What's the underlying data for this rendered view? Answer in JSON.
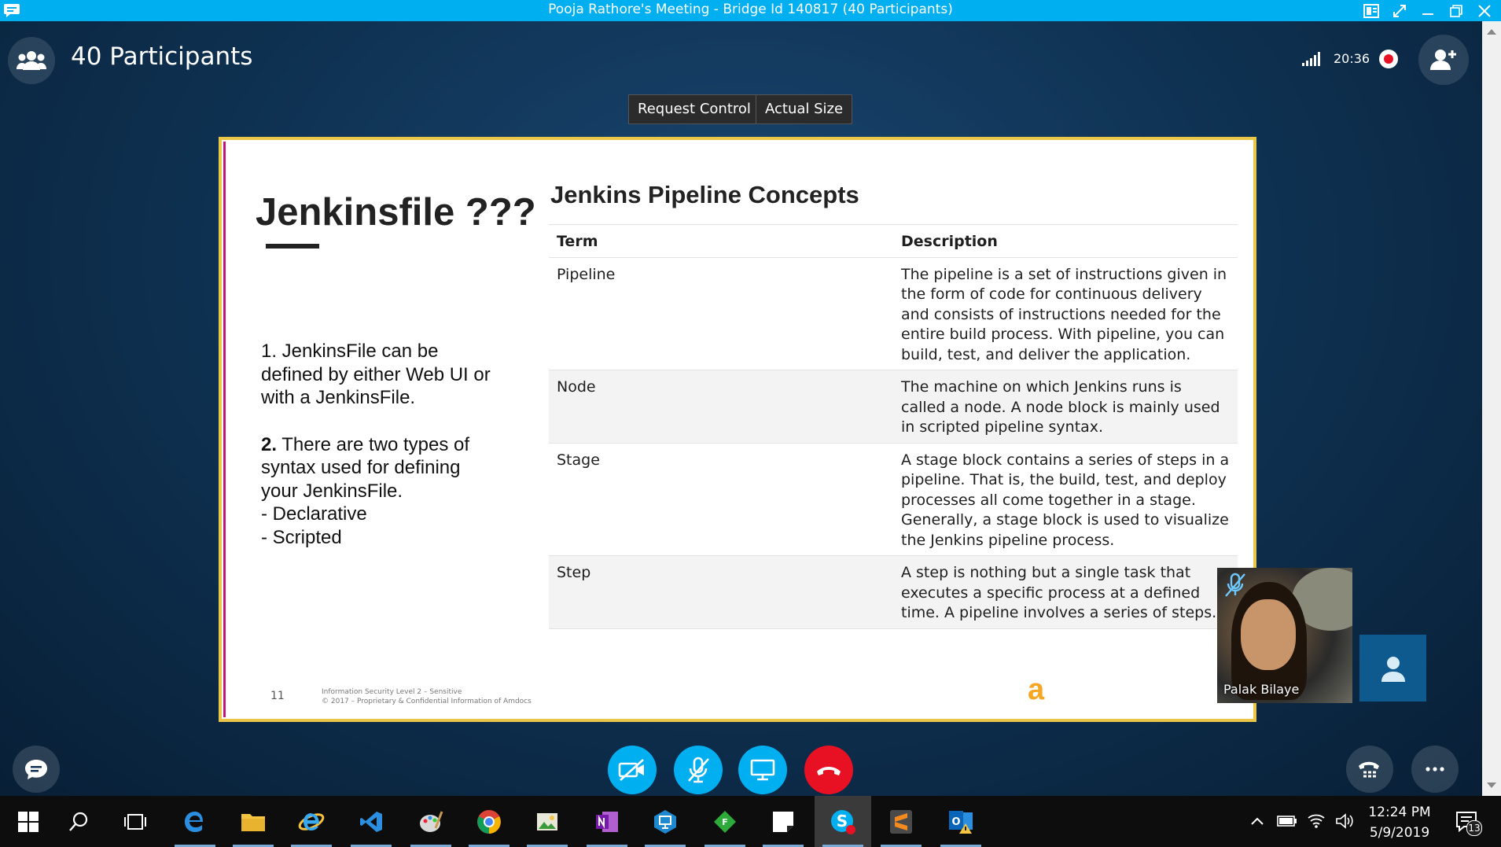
{
  "window": {
    "title": "Pooja Rathore's Meeting - Bridge Id 140817 (40 Participants)"
  },
  "meeting": {
    "participants_label": "40 Participants",
    "call_duration": "20:36",
    "request_control_label": "Request Control",
    "actual_size_label": "Actual Size"
  },
  "slide": {
    "heading": "Jenkinsfile ???",
    "point1": "1. JenkinsFile can be defined by either Web UI or with a JenkinsFile.",
    "point2_number": "2.",
    "point2_text": " There are two types of syntax used for defining your JenkinsFile.",
    "point2_item1": "- Declarative",
    "point2_item2": "- Scripted",
    "table_title": "Jenkins Pipeline Concepts",
    "col_term": "Term",
    "col_description": "Description",
    "rows": [
      {
        "term": "Pipeline",
        "description": "The pipeline is a set of instructions given in the form of code for continuous delivery and consists of instructions needed for the entire build process. With pipeline, you can build, test, and deliver the application."
      },
      {
        "term": "Node",
        "description": "The machine on which Jenkins runs is called a node. A node block is mainly used in scripted pipeline syntax."
      },
      {
        "term": "Stage",
        "description": "A stage block contains a series of steps in a pipeline. That is, the build, test, and deploy processes all come together in a stage. Generally, a stage block is used to visualize the Jenkins pipeline process."
      },
      {
        "term": "Step",
        "description": "A step is nothing but a single task that executes a specific process at a defined time. A pipeline involves a series of steps."
      }
    ],
    "page_number": "11",
    "footer_line1": "Information Security Level 2 – Sensitive",
    "footer_line2": "© 2017 – Proprietary & Confidential Information of Amdocs",
    "logo_text": "a"
  },
  "video": {
    "participant_name": "Palak Bilaye"
  },
  "taskbar": {
    "time": "12:24 PM",
    "date": "5/9/2019",
    "notification_count": "13"
  },
  "colors": {
    "skype_blue": "#00aff0",
    "end_call_red": "#e81123",
    "slide_border": "#e9c548",
    "slide_accent": "#c4137c"
  }
}
